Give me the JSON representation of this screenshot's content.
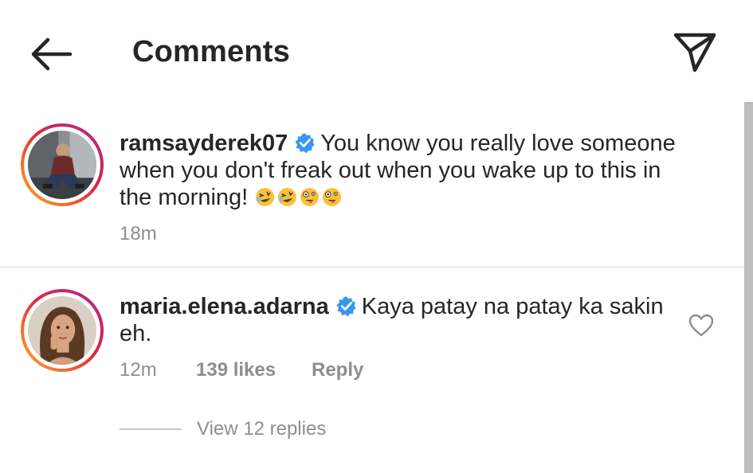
{
  "header": {
    "title": "Comments"
  },
  "caption": {
    "username": "ramsayderek07",
    "text_line1": "You know you really love someone",
    "text_line2": "when you don't freak out when you wake up to this in",
    "text_line3": "the morning!",
    "emojis": [
      "rolling-on-floor-laughing",
      "rolling-on-floor-laughing",
      "zany-face",
      "zany-face"
    ],
    "time": "18m"
  },
  "comment": {
    "username": "maria.elena.adarna",
    "text_line1": "Kaya patay na patay ka sakin",
    "text_line2": "eh.",
    "time": "12m",
    "likes": "139 likes",
    "reply_label": "Reply",
    "view_replies": "View 12 replies"
  },
  "colors": {
    "verified": "#3897f0",
    "text": "#262626",
    "muted": "#8e8e8e",
    "divider": "#dbdbdb"
  },
  "icons": {
    "back": "arrow-left-icon",
    "send": "direct-send-icon",
    "verified": "verified-badge-icon",
    "like": "heart-outline-icon"
  }
}
